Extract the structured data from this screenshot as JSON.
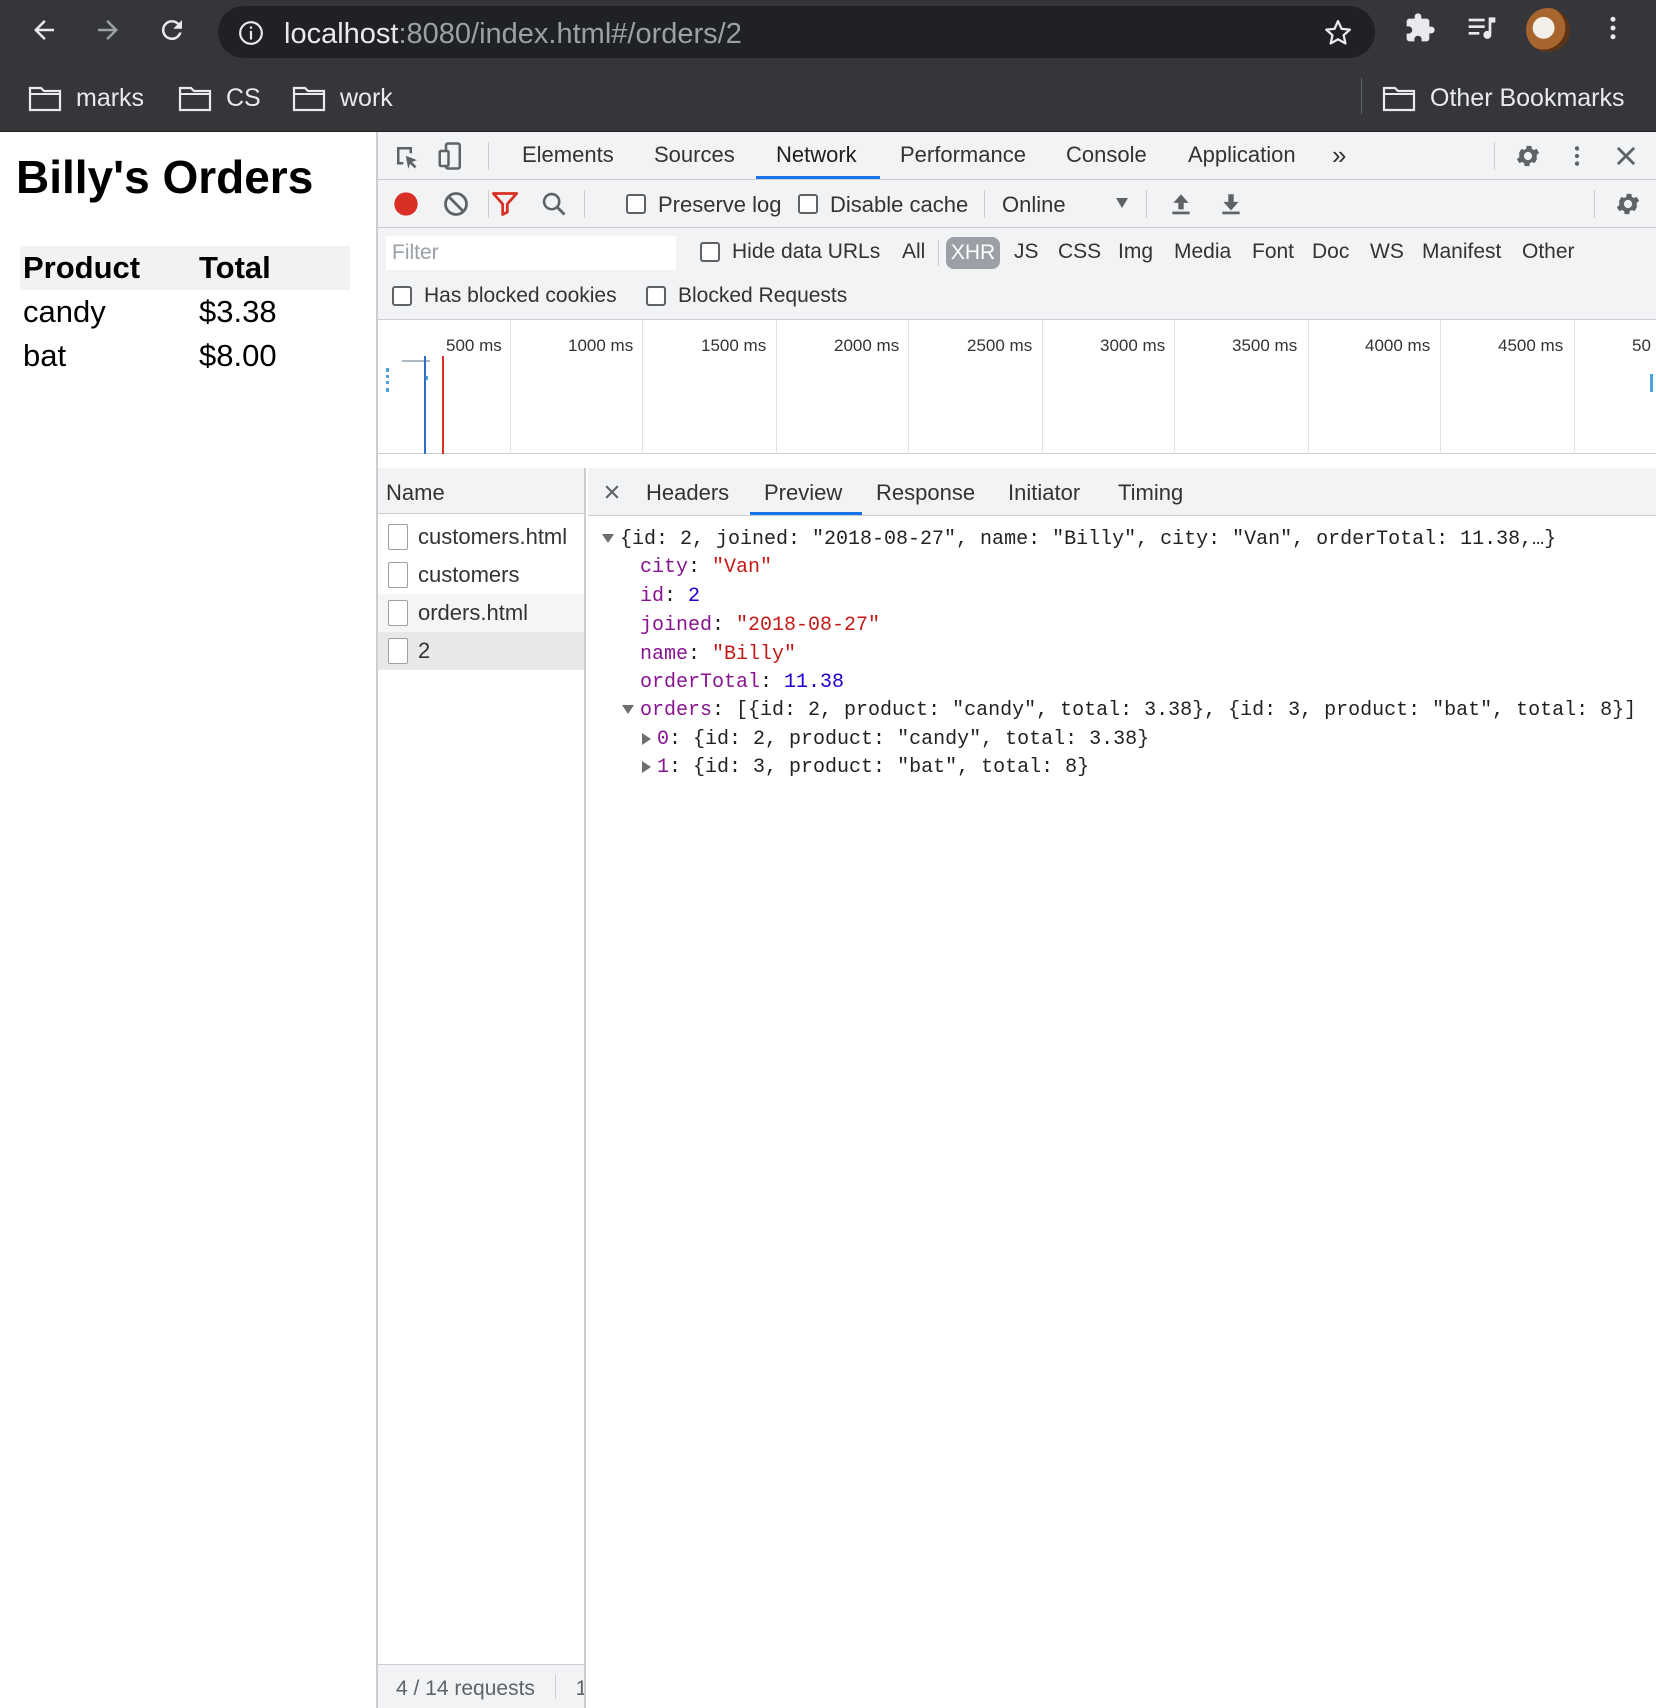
{
  "browser": {
    "url_host": "localhost",
    "url_rest": ":8080/index.html#/orders/2",
    "bookmarks": [
      "marks",
      "CS",
      "work"
    ],
    "other_bookmarks": "Other Bookmarks"
  },
  "page": {
    "title": "Billy's Orders",
    "table": {
      "headers": [
        "Product",
        "Total"
      ],
      "rows": [
        [
          "candy",
          "$3.38"
        ],
        [
          "bat",
          "$8.00"
        ]
      ]
    }
  },
  "devtools": {
    "tabs": [
      "Elements",
      "Sources",
      "Network",
      "Performance",
      "Console",
      "Application"
    ],
    "active_tab": "Network",
    "toolbar": {
      "preserve_log": "Preserve log",
      "disable_cache": "Disable cache",
      "throttle": "Online"
    },
    "filter": {
      "placeholder": "Filter",
      "hide_data_urls": "Hide data URLs",
      "types": [
        "All",
        "XHR",
        "JS",
        "CSS",
        "Img",
        "Media",
        "Font",
        "Doc",
        "WS",
        "Manifest",
        "Other"
      ],
      "active_type": "XHR",
      "has_blocked_cookies": "Has blocked cookies",
      "blocked_requests": "Blocked Requests"
    },
    "timeline_ticks": [
      "500 ms",
      "1000 ms",
      "1500 ms",
      "2000 ms",
      "2500 ms",
      "3000 ms",
      "3500 ms",
      "4000 ms",
      "4500 ms",
      "50"
    ],
    "requests": {
      "header": "Name",
      "items": [
        "customers.html",
        "customers",
        "orders.html",
        "2"
      ],
      "selected": "2",
      "status": "4 / 14 requests",
      "status_extra": "1"
    },
    "detail": {
      "tabs": [
        "Headers",
        "Preview",
        "Response",
        "Initiator",
        "Timing"
      ],
      "active_tab": "Preview",
      "preview": {
        "summary": "{id: 2, joined: \"2018-08-27\", name: \"Billy\", city: \"Van\", orderTotal: 11.38,…}",
        "fields": [
          {
            "key": "city",
            "value": "\"Van\"",
            "kind": "s"
          },
          {
            "key": "id",
            "value": "2",
            "kind": "n"
          },
          {
            "key": "joined",
            "value": "\"2018-08-27\"",
            "kind": "s"
          },
          {
            "key": "name",
            "value": "\"Billy\"",
            "kind": "s"
          },
          {
            "key": "orderTotal",
            "value": "11.38",
            "kind": "n"
          }
        ],
        "orders_key": "orders",
        "orders_summary": "[{id: 2, product: \"candy\", total: 3.38}, {id: 3, product: \"bat\", total: 8}]",
        "order_items": [
          {
            "index": "0",
            "summary": "{id: 2, product: \"candy\", total: 3.38}"
          },
          {
            "index": "1",
            "summary": "{id: 3, product: \"bat\", total: 8}"
          }
        ]
      }
    }
  }
}
